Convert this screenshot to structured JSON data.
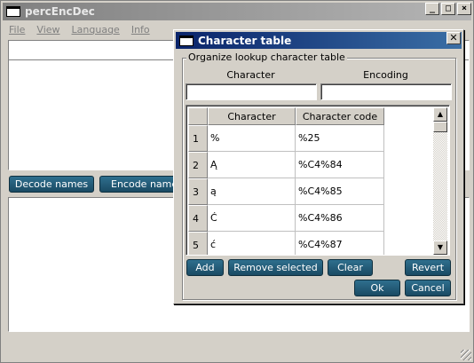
{
  "main": {
    "title": "percEncDec",
    "menu": [
      "File",
      "View",
      "Language",
      "Info"
    ],
    "buttons": {
      "decode": "Decode names",
      "encode": "Encode names"
    },
    "window_controls": {
      "minimize": "_",
      "maximize": "□",
      "close": "×"
    }
  },
  "dialog": {
    "title": "Character table",
    "group_title": "Organize lookup character table",
    "labels": {
      "character": "Character",
      "encoding": "Encoding"
    },
    "inputs": {
      "character_value": "",
      "encoding_value": ""
    },
    "table": {
      "headers": [
        "Character",
        "Character code"
      ],
      "rows": [
        {
          "n": "1",
          "character": "%",
          "code": "%25"
        },
        {
          "n": "2",
          "character": "Ą",
          "code": "%C4%84"
        },
        {
          "n": "3",
          "character": "ą",
          "code": "%C4%85"
        },
        {
          "n": "4",
          "character": "Ć",
          "code": "%C4%86"
        },
        {
          "n": "5",
          "character": "ć",
          "code": "%C4%87"
        }
      ]
    },
    "buttons": {
      "add": "Add",
      "remove_selected": "Remove selected",
      "clear": "Clear",
      "revert": "Revert",
      "ok": "Ok",
      "cancel": "Cancel"
    },
    "close_glyph": "✕"
  },
  "scroll_glyphs": {
    "up": "▲",
    "down": "▼"
  }
}
